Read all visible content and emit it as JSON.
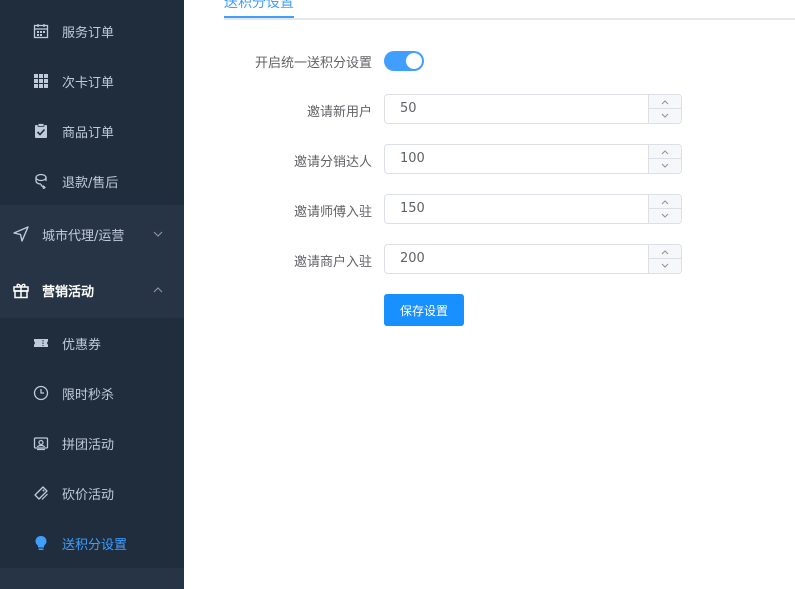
{
  "sidebar": {
    "items": [
      {
        "label": "服务订单",
        "icon": "calendar-icon"
      },
      {
        "label": "次卡订单",
        "icon": "grid-icon"
      },
      {
        "label": "商品订单",
        "icon": "clipboard-check-icon"
      },
      {
        "label": "退款/售后",
        "icon": "refund-icon"
      },
      {
        "label": "城市代理/运营",
        "icon": "navigation-icon"
      },
      {
        "label": "营销活动",
        "icon": "gift-icon"
      },
      {
        "label": "优惠券",
        "icon": "ticket-icon"
      },
      {
        "label": "限时秒杀",
        "icon": "clock-icon"
      },
      {
        "label": "拼团活动",
        "icon": "group-buy-icon"
      },
      {
        "label": "砍价活动",
        "icon": "bargain-icon"
      },
      {
        "label": "送积分设置",
        "icon": "bulb-icon"
      }
    ],
    "colors": {
      "bg": "#263445",
      "sub_bg": "#1f2d3d",
      "text": "#bfcbd9",
      "active": "#409eff"
    }
  },
  "tab": {
    "label": "送积分设置"
  },
  "form": {
    "switch_label": "开启统一送积分设置",
    "switch_on": true,
    "fields": [
      {
        "label": "邀请新用户",
        "value": "50"
      },
      {
        "label": "邀请分销达人",
        "value": "100"
      },
      {
        "label": "邀请师傅入驻",
        "value": "150"
      },
      {
        "label": "邀请商户入驻",
        "value": "200"
      }
    ],
    "save_label": "保存设置"
  }
}
